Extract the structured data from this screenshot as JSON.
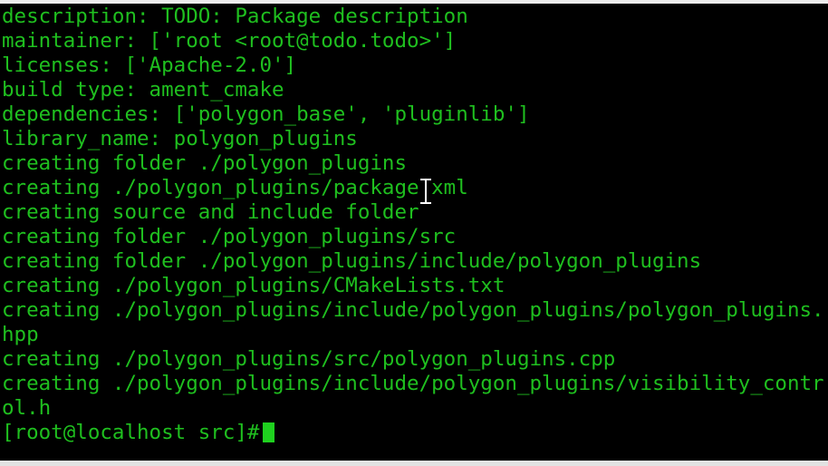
{
  "colors": {
    "background": "#000000",
    "text": "#1fbf1f",
    "cursor": "#1fd11f"
  },
  "terminal": {
    "lines": [
      "description: TODO: Package description",
      "maintainer: ['root <root@todo.todo>']",
      "licenses: ['Apache-2.0']",
      "build type: ament_cmake",
      "dependencies: ['polygon_base', 'pluginlib']",
      "library_name: polygon_plugins",
      "creating folder ./polygon_plugins",
      "creating ./polygon_plugins/package.xml",
      "creating source and include folder",
      "creating folder ./polygon_plugins/src",
      "creating folder ./polygon_plugins/include/polygon_plugins",
      "creating ./polygon_plugins/CMakeLists.txt",
      "creating ./polygon_plugins/include/polygon_plugins/polygon_plugins.",
      "hpp",
      "creating ./polygon_plugins/src/polygon_plugins.cpp",
      "creating ./polygon_plugins/include/polygon_plugins/visibility_contr",
      "ol.h"
    ],
    "prompt": "[root@localhost src]#",
    "icons": {
      "text_cursor": "ibeam-cursor-icon",
      "block_cursor": "block-cursor"
    }
  }
}
